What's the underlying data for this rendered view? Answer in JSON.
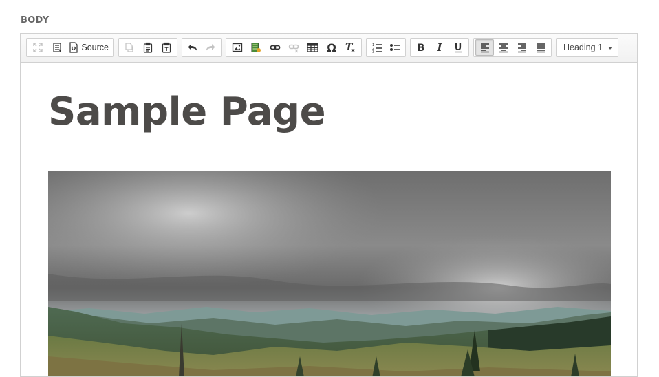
{
  "field": {
    "label": "BODY"
  },
  "toolbar": {
    "groups": [
      {
        "name": "view",
        "items": [
          {
            "icon": "maximize-icon",
            "enabled": false
          },
          {
            "icon": "show-blocks-icon",
            "enabled": true
          },
          {
            "icon": "source-icon",
            "label": "Source",
            "enabled": true
          }
        ]
      },
      {
        "name": "clipboard",
        "items": [
          {
            "icon": "copy-icon",
            "enabled": false
          },
          {
            "icon": "paste-icon",
            "enabled": true
          },
          {
            "icon": "paste-text-icon",
            "enabled": true
          }
        ]
      },
      {
        "name": "history",
        "items": [
          {
            "icon": "undo-icon",
            "enabled": true
          },
          {
            "icon": "redo-icon",
            "enabled": false
          }
        ]
      },
      {
        "name": "insert",
        "items": [
          {
            "icon": "image-icon",
            "enabled": true
          },
          {
            "icon": "media-icon",
            "enabled": true
          },
          {
            "icon": "link-icon",
            "enabled": true
          },
          {
            "icon": "unlink-icon",
            "enabled": false
          },
          {
            "icon": "table-icon",
            "enabled": true
          },
          {
            "icon": "special-char-icon",
            "enabled": true
          },
          {
            "icon": "remove-format-icon",
            "enabled": true
          }
        ]
      },
      {
        "name": "lists",
        "items": [
          {
            "icon": "numbered-list-icon",
            "enabled": true
          },
          {
            "icon": "bulleted-list-icon",
            "enabled": true
          }
        ]
      },
      {
        "name": "basic-styles",
        "items": [
          {
            "icon": "bold-icon",
            "enabled": true
          },
          {
            "icon": "italic-icon",
            "enabled": true
          },
          {
            "icon": "underline-icon",
            "enabled": true
          }
        ]
      },
      {
        "name": "alignment",
        "items": [
          {
            "icon": "align-left-icon",
            "enabled": true,
            "active": true
          },
          {
            "icon": "align-center-icon",
            "enabled": true
          },
          {
            "icon": "align-right-icon",
            "enabled": true
          },
          {
            "icon": "justify-icon",
            "enabled": true
          }
        ]
      }
    ],
    "format": {
      "selected": "Heading 1"
    }
  },
  "content": {
    "heading": "Sample Page",
    "image": {
      "subject": "cloudy sky over forested mountain ridges"
    }
  },
  "colors": {
    "heading": "#4d4b49",
    "toolbar_bg": "#f4f4f4",
    "border": "#d1d1d1",
    "label": "#666666"
  }
}
